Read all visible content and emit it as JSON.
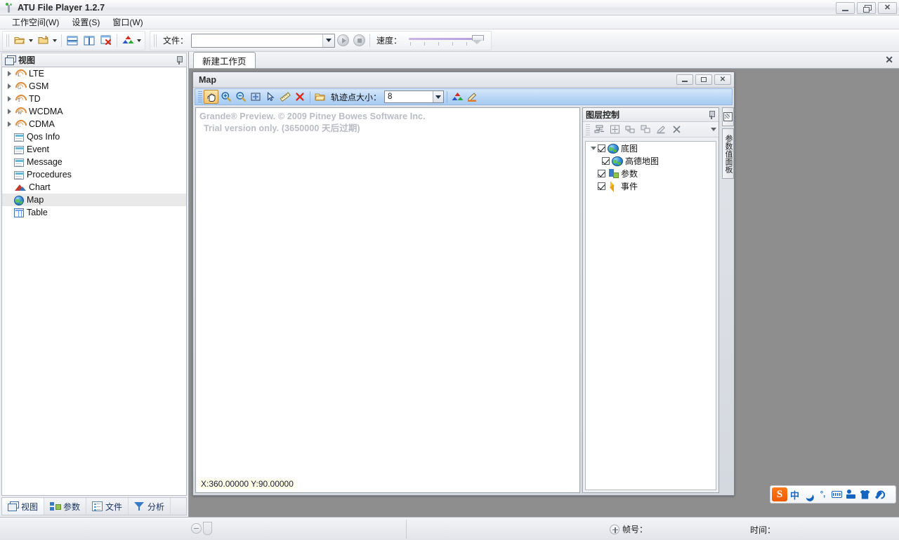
{
  "window": {
    "title": "ATU File Player 1.2.7",
    "icon": "antenna-icon",
    "controls": {
      "minimize": "minimize-icon",
      "restore": "restore-icon",
      "close": "close-icon"
    }
  },
  "menubar": {
    "items": [
      {
        "label": "工作空间(W)",
        "name": "menu-workspace"
      },
      {
        "label": "设置(S)",
        "name": "menu-settings"
      },
      {
        "label": "窗口(W)",
        "name": "menu-window"
      }
    ]
  },
  "toolbar": {
    "buttons": [
      {
        "name": "open-file-button",
        "icon": "open-folder-icon",
        "dropdown": true
      },
      {
        "name": "open-project-button",
        "icon": "folder-up-icon",
        "dropdown": true
      },
      {
        "name": "tile-horizontal-button",
        "icon": "split-horizontal-icon"
      },
      {
        "name": "tile-vertical-button",
        "icon": "split-vertical-icon"
      },
      {
        "name": "close-all-windows-button",
        "icon": "window-close-icon"
      },
      {
        "name": "color-legend-button",
        "icon": "color-triangles-icon",
        "dropdown": true
      }
    ],
    "file_label": "文件：",
    "file_value": "",
    "file_placeholder": "",
    "play_button": "play-icon",
    "stop_button": "stop-icon",
    "speed_label": "速度：",
    "speed_value": 100
  },
  "sidebar": {
    "title": "视图",
    "pin": "pin-icon",
    "tree": [
      {
        "label": "LTE",
        "icon": "radio-tower-icon",
        "letter": "L",
        "expandable": true,
        "selected": false
      },
      {
        "label": "GSM",
        "icon": "radio-tower-icon",
        "letter": "G",
        "expandable": true,
        "selected": false
      },
      {
        "label": "TD",
        "icon": "radio-tower-icon",
        "letter": "T",
        "expandable": true,
        "selected": false
      },
      {
        "label": "WCDMA",
        "icon": "radio-tower-icon",
        "letter": "W",
        "expandable": true,
        "selected": false
      },
      {
        "label": "CDMA",
        "icon": "radio-tower-icon",
        "letter": "C",
        "expandable": true,
        "selected": false
      },
      {
        "label": "Qos Info",
        "icon": "window-doc-icon",
        "letter": "",
        "expandable": false,
        "selected": false
      },
      {
        "label": "Event",
        "icon": "window-doc-icon",
        "letter": "",
        "expandable": false,
        "selected": false
      },
      {
        "label": "Message",
        "icon": "window-doc-icon",
        "letter": "",
        "expandable": false,
        "selected": false
      },
      {
        "label": "Procedures",
        "icon": "window-doc-icon",
        "letter": "",
        "expandable": false,
        "selected": false
      },
      {
        "label": "Chart",
        "icon": "chart-icon",
        "letter": "",
        "expandable": false,
        "selected": false
      },
      {
        "label": "Map",
        "icon": "globe-icon",
        "letter": "",
        "expandable": false,
        "selected": true
      },
      {
        "label": "Table",
        "icon": "table-icon",
        "letter": "",
        "expandable": false,
        "selected": false
      }
    ],
    "tabs": [
      {
        "label": "视图",
        "icon": "view-icon",
        "active": true
      },
      {
        "label": "参数",
        "icon": "parameter-icon",
        "active": false
      },
      {
        "label": "文件",
        "icon": "file-list-icon",
        "active": false
      },
      {
        "label": "分析",
        "icon": "filter-icon",
        "active": false
      }
    ]
  },
  "workspace": {
    "tab_label": "新建工作页",
    "close_icon": "close-icon"
  },
  "map_window": {
    "title": "Map",
    "controls": {
      "minimize": "minimize-icon",
      "maximize": "maximize-icon",
      "close": "close-icon"
    },
    "toolbar": {
      "tools": [
        {
          "name": "pan-tool",
          "icon": "hand-icon",
          "active": true
        },
        {
          "name": "zoom-in-tool",
          "icon": "zoom-in-icon",
          "active": false
        },
        {
          "name": "zoom-out-tool",
          "icon": "zoom-out-icon",
          "active": false
        },
        {
          "name": "zoom-to-fit-tool",
          "icon": "fit-extent-icon",
          "active": false
        },
        {
          "name": "select-tool",
          "icon": "cursor-arrow-icon",
          "active": false
        },
        {
          "name": "measure-tool",
          "icon": "ruler-icon",
          "active": false
        },
        {
          "name": "clear-tool",
          "icon": "red-x-icon",
          "active": false
        }
      ],
      "open_layer_button": {
        "name": "open-layer-button",
        "icon": "open-folder-icon"
      },
      "point_size_label": "轨迹点大小：",
      "point_size_value": "8",
      "legend_button": {
        "name": "color-legend-button",
        "icon": "color-triangles-icon"
      },
      "draw_button": {
        "name": "draw-tool-button",
        "icon": "pencil-icon"
      }
    },
    "canvas": {
      "watermark_line1": "Grande® Preview. © 2009 Pitney Bowes Software Inc.",
      "watermark_line2": "Trial version only. (3650000 天后过期)",
      "coordinates": "X:360.00000 Y:90.00000"
    },
    "layer_panel": {
      "title": "图层控制",
      "pin": "pin-icon",
      "toolbar": [
        {
          "name": "layer-properties-button",
          "icon": "layer-properties-icon"
        },
        {
          "name": "zoom-to-layer-button",
          "icon": "fit-extent-icon"
        },
        {
          "name": "add-layer-button",
          "icon": "add-layer-icon"
        },
        {
          "name": "duplicate-layer-button",
          "icon": "copy-layer-icon"
        },
        {
          "name": "style-layer-button",
          "icon": "pencil-underline-icon"
        },
        {
          "name": "remove-layer-button",
          "icon": "close-x-icon"
        },
        {
          "name": "layer-overflow-button",
          "icon": "chevron-down-icon"
        }
      ],
      "layers": [
        {
          "label": "底图",
          "icon": "globe-icon",
          "checked": true,
          "expandable": true,
          "level": 0
        },
        {
          "label": "高德地图",
          "icon": "globe-icon",
          "checked": true,
          "expandable": false,
          "level": 1
        },
        {
          "label": "参数",
          "icon": "parameter-icon",
          "checked": true,
          "expandable": false,
          "level": 0
        },
        {
          "label": "事件",
          "icon": "event-lightning-icon",
          "checked": true,
          "expandable": false,
          "level": 0
        }
      ]
    },
    "side_tabs": [
      {
        "label": "",
        "icon": "map-thumbnail-icon",
        "name": "map-overview-tab"
      },
      {
        "label": "参数值面板",
        "icon": "",
        "name": "parameter-value-tab"
      }
    ]
  },
  "statusbar": {
    "zoom_out_icon": "minus-circle-icon",
    "slider_handle": "slider-handle",
    "expand_icon": "plus-circle-icon",
    "frame_label": "帧号：",
    "frame_value": "",
    "time_label": "时间：",
    "time_value": ""
  },
  "ime": {
    "logo": "S",
    "items": [
      {
        "name": "ime-mode-chinese",
        "label": "中"
      },
      {
        "name": "ime-moon-icon",
        "label": ""
      },
      {
        "name": "ime-punctuation-icon",
        "label": "°,"
      },
      {
        "name": "ime-keyboard-icon",
        "label": ""
      },
      {
        "name": "ime-toolbox-icon",
        "label": ""
      },
      {
        "name": "ime-skin-icon",
        "label": ""
      },
      {
        "name": "ime-settings-icon",
        "label": ""
      }
    ]
  },
  "colors": {
    "accent": "#3a7bc8",
    "toolbar_blue": "#b9d6f6",
    "selection": "#e9e9ea",
    "desktop": "#8e8e8e"
  }
}
